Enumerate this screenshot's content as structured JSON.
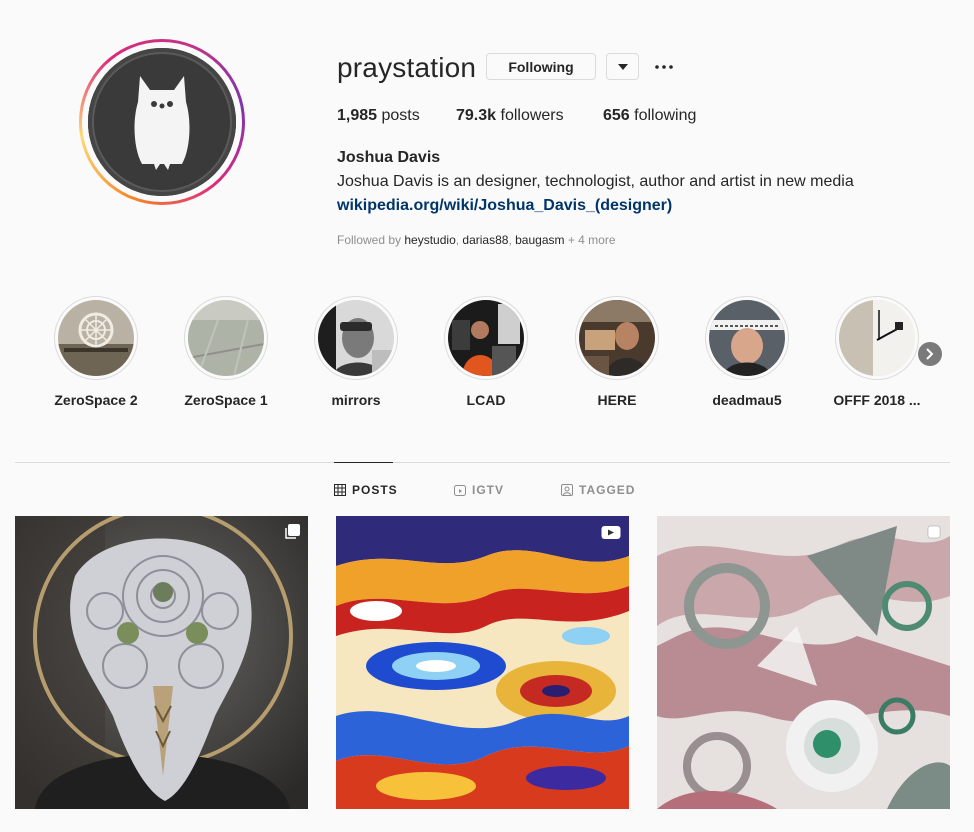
{
  "profile": {
    "username": "praystation",
    "following_label": "Following",
    "stats": {
      "posts_count": "1,985",
      "posts_label": " posts",
      "followers_count": "79.3k",
      "followers_label": " followers",
      "following_count": "656",
      "following_label": " following"
    },
    "full_name": "Joshua Davis",
    "bio": "Joshua Davis is an designer, technologist, author and artist in new media",
    "link": "wikipedia.org/wiki/Joshua_Davis_(designer)",
    "followed_by": {
      "prefix": "Followed by ",
      "names": [
        "heystudio",
        "darias88",
        "baugasm"
      ],
      "sep1": ", ",
      "sep2": ", ",
      "more": " + 4 more"
    }
  },
  "highlights": [
    {
      "label": "ZeroSpace 2"
    },
    {
      "label": "ZeroSpace 1"
    },
    {
      "label": "mirrors"
    },
    {
      "label": "LCAD"
    },
    {
      "label": "HERE"
    },
    {
      "label": "deadmau5"
    },
    {
      "label": "OFFF 2018 ..."
    }
  ],
  "tabs": [
    {
      "label": "POSTS",
      "icon": "grid-icon",
      "active": true
    },
    {
      "label": "IGTV",
      "icon": "igtv-icon",
      "active": false
    },
    {
      "label": "TAGGED",
      "icon": "tagged-icon",
      "active": false
    }
  ],
  "posts": [
    {
      "subject": "white lace mask sculpture",
      "badge": "carousel-icon"
    },
    {
      "subject": "psychedelic marbled swirl pattern",
      "badge": "igtv-badge-icon"
    },
    {
      "subject": "abstract grey and green generative shapes",
      "badge": "carousel-icon"
    }
  ],
  "colors": {
    "background": "#fafafa",
    "text": "#262626",
    "muted": "#8e8e8e",
    "link": "#003569",
    "border": "#dbdbdb"
  }
}
